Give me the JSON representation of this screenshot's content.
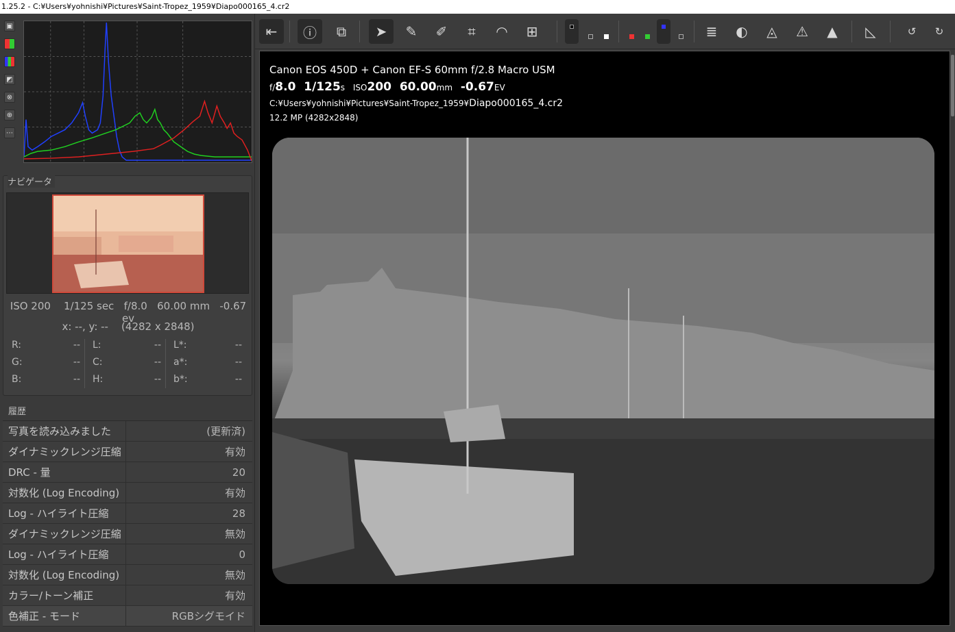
{
  "window": {
    "title": "1.25.2 - C:¥Users¥yohnishi¥Pictures¥Saint-Tropez_1959¥Diapo000165_4.cr2"
  },
  "histogram": {
    "buttons": [
      "histogram-icon",
      "raw-icon",
      "rgb-icon",
      "luminance-icon",
      "chroma-icon",
      "crosshair-icon",
      "more-icon"
    ]
  },
  "navigator": {
    "title": "ナビゲータ",
    "exif": {
      "iso": "ISO 200",
      "shutter": "1/125 sec",
      "aperture": "f/8.0",
      "focal": "60.00 mm",
      "ev": "-0.67 ev"
    },
    "coords": "x: --, y: --",
    "dimensions": "(4282 x 2848)",
    "values": {
      "r_label": "R:",
      "r": "--",
      "g_label": "G:",
      "g": "--",
      "b_label": "B:",
      "b": "--",
      "l_label": "L:",
      "l": "--",
      "c_label": "C:",
      "c": "--",
      "h_label": "H:",
      "h": "--",
      "lstar_label": "L*:",
      "lstar": "--",
      "astar_label": "a*:",
      "astar": "--",
      "bstar_label": "b*:",
      "bstar": "--"
    }
  },
  "history": {
    "title": "履歴",
    "rows": [
      {
        "action": "写真を読み込みました",
        "value": "(更新済)"
      },
      {
        "action": "ダイナミックレンジ圧縮",
        "value": "有効"
      },
      {
        "action": "DRC - 量",
        "value": "20"
      },
      {
        "action": "対数化 (Log Encoding)",
        "value": "有効"
      },
      {
        "action": "Log - ハイライト圧縮",
        "value": "28"
      },
      {
        "action": "ダイナミックレンジ圧縮",
        "value": "無効"
      },
      {
        "action": "Log - ハイライト圧縮",
        "value": "0"
      },
      {
        "action": "対数化 (Log Encoding)",
        "value": "無効"
      },
      {
        "action": "カラー/トーン補正",
        "value": "有効"
      },
      {
        "action": "色補正 - モード",
        "value": "RGBシグモイド"
      }
    ]
  },
  "image_info": {
    "camera": "Canon EOS 450D + Canon EF-S 60mm f/2.8 Macro USM",
    "f_prefix": "f/",
    "aperture": "8.0",
    "shutter": "1/125",
    "shutter_unit": "s",
    "iso_prefix": "ISO",
    "iso": "200",
    "focal": "60.00",
    "focal_unit": "mm",
    "ev": "-0.67",
    "ev_unit": "EV",
    "path_prefix": "C:¥Users¥yohnishi¥Pictures¥Saint-Tropez_1959¥",
    "filename": "Diapo000165_4.cr2",
    "resolution": "12.2 MP (4282x2848)"
  },
  "toolbar": {
    "items": [
      "panel-toggle-icon",
      "info-icon",
      "before-after-icon",
      "hand-tool-icon",
      "white-balance-picker-icon",
      "color-picker-icon",
      "crop-icon",
      "straighten-icon",
      "perspective-icon",
      "preview-r-icon",
      "preview-g-icon",
      "preview-b-icon",
      "preview-channel-icon",
      "focus-mask-icon",
      "shadow-clip-icon",
      "highlight-clip-icon",
      "warning-icon",
      "flip-icon",
      "rotate-left-icon",
      "rotate-right-icon"
    ]
  },
  "colors": {
    "histogram_red": "#e02020",
    "histogram_green": "#20d020",
    "histogram_blue": "#2040ff",
    "accent_red": "#d0493a"
  }
}
